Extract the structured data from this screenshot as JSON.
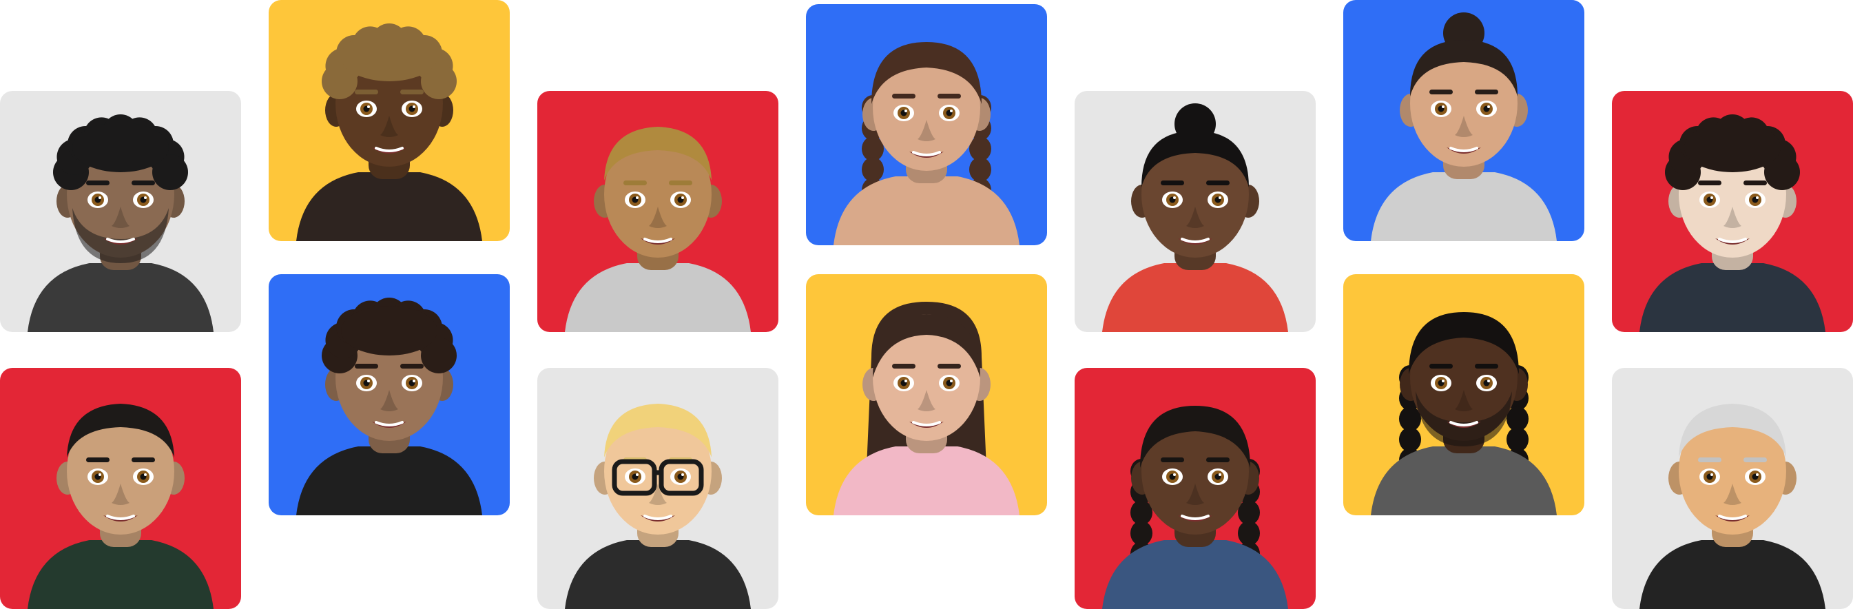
{
  "colors": {
    "gray": "#e6e6e6",
    "yellow": "#fec63a",
    "red": "#e32636",
    "blue": "#2f6ef6"
  },
  "tiles": [
    {
      "bg": "gray",
      "skin": "#8a6a52",
      "hair": "#1b1a1a",
      "style": "curly",
      "shirt": "#3a3a3a",
      "beard": true,
      "glasses": false
    },
    {
      "bg": "red",
      "skin": "#caa07a",
      "hair": "#1d1a18",
      "style": "short",
      "shirt": "#243a2e",
      "beard": false,
      "glasses": false
    },
    {
      "bg": "yellow",
      "skin": "#5c3a22",
      "hair": "#8a6a3a",
      "style": "curly",
      "shirt": "#2e2420",
      "beard": false,
      "glasses": false
    },
    {
      "bg": "blue",
      "skin": "#9a7458",
      "hair": "#2a1d17",
      "style": "curly",
      "shirt": "#1f1f1f",
      "beard": false,
      "glasses": false
    },
    {
      "bg": "red",
      "skin": "#b98957",
      "hair": "#b08a3e",
      "style": "short",
      "shirt": "#c9c9c9",
      "beard": false,
      "glasses": false
    },
    {
      "bg": "gray",
      "skin": "#f0c79a",
      "hair": "#f1d27a",
      "style": "short",
      "shirt": "#2c2c2c",
      "beard": false,
      "glasses": true
    },
    {
      "bg": "blue",
      "skin": "#d9a98a",
      "hair": "#4a2f22",
      "style": "braids",
      "shirt": "#d9a98a",
      "beard": false,
      "glasses": false
    },
    {
      "bg": "yellow",
      "skin": "#e4b69a",
      "hair": "#3a2820",
      "style": "long",
      "shirt": "#f2b8c6",
      "beard": false,
      "glasses": false
    },
    {
      "bg": "gray",
      "skin": "#6a4630",
      "hair": "#141212",
      "style": "bun",
      "shirt": "#e0463a",
      "beard": false,
      "glasses": false
    },
    {
      "bg": "red",
      "skin": "#5d3c28",
      "hair": "#1a1614",
      "style": "braids",
      "shirt": "#3a5680",
      "beard": false,
      "glasses": false
    },
    {
      "bg": "blue",
      "skin": "#d8a784",
      "hair": "#2b211c",
      "style": "bun",
      "shirt": "#cfcfcf",
      "beard": false,
      "glasses": false
    },
    {
      "bg": "yellow",
      "skin": "#4f3120",
      "hair": "#141110",
      "style": "braids",
      "shirt": "#5a5a5a",
      "beard": true,
      "glasses": false
    },
    {
      "bg": "red",
      "skin": "#efd9c6",
      "hair": "#241a16",
      "style": "curly",
      "shirt": "#2b3440",
      "beard": false,
      "glasses": false
    },
    {
      "bg": "gray",
      "skin": "#e7b27c",
      "hair": "#d7d7d7",
      "style": "short",
      "shirt": "#232323",
      "beard": false,
      "glasses": false
    }
  ]
}
